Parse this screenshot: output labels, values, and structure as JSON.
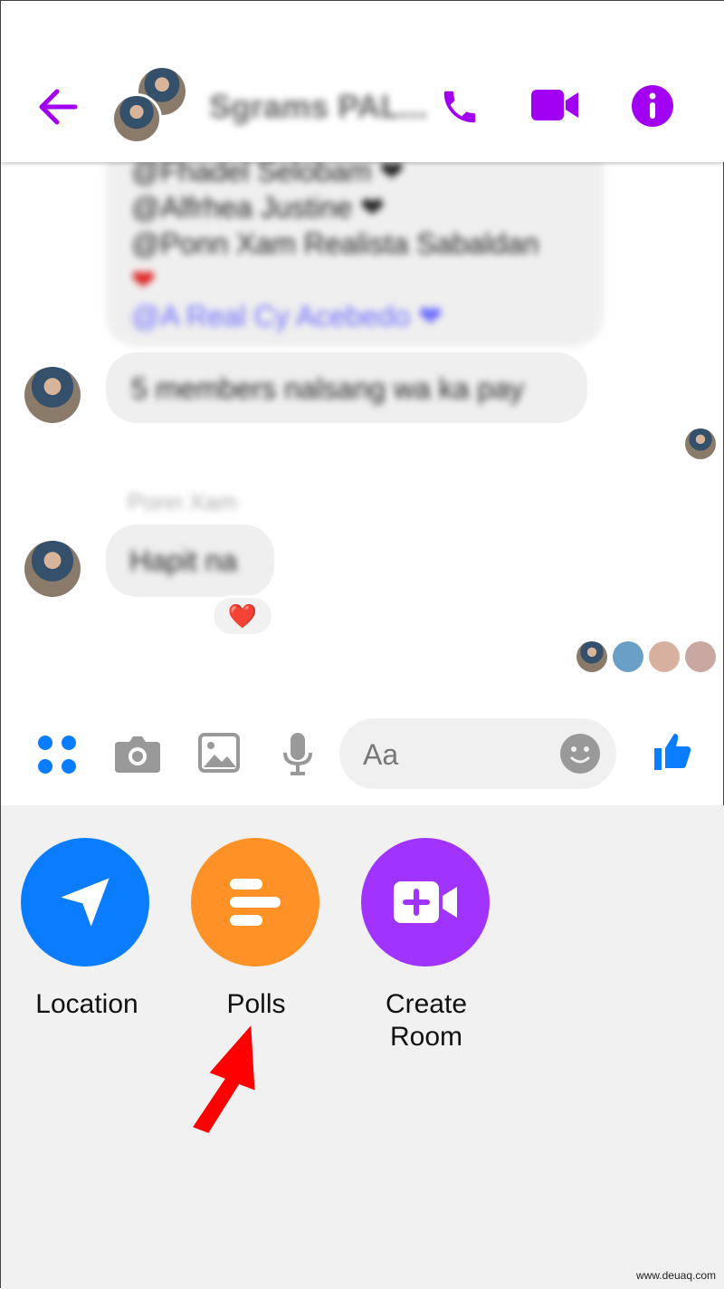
{
  "header": {
    "title": "Sgrams PAL...",
    "icons": [
      "back-arrow-icon",
      "phone-icon",
      "video-camera-icon",
      "info-icon"
    ],
    "accent": "#a100f2"
  },
  "messages": {
    "mentions": [
      "@Fhadel Selobam ❤",
      "@Alfrhea Justine ❤",
      "@Ponn Xam Realista Sabaldan",
      "❤",
      "@A Real Cy Acebedo ❤"
    ],
    "msg2": "5 members nalsang wa ka pay",
    "sender": "Ponn Xam",
    "msg3": "Hapit na",
    "reaction": "❤️"
  },
  "composer": {
    "placeholder": "Aa",
    "icons": [
      "apps-icon",
      "camera-icon",
      "gallery-icon",
      "microphone-icon",
      "emoji-icon",
      "thumbs-up-icon"
    ],
    "accent": "#0a7cff"
  },
  "tray": {
    "items": [
      {
        "label": "Location",
        "color": "#0a7cff",
        "icon": "location-arrow-icon"
      },
      {
        "label": "Polls",
        "color": "#ff9126",
        "icon": "polls-icon"
      },
      {
        "label": "Create\nRoom",
        "color": "#a033ff",
        "icon": "video-add-icon"
      }
    ]
  },
  "watermark": "www.deuaq.com"
}
